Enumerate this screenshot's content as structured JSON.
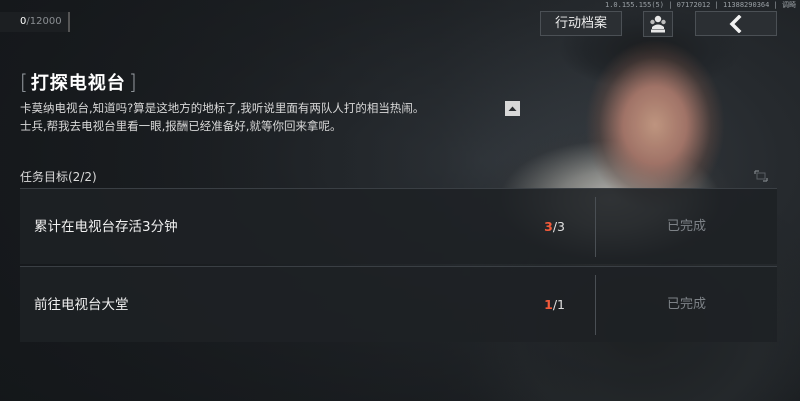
{
  "currency": {
    "current": "0",
    "max": "/12000"
  },
  "version_text": "1.0.155.155(5) | 07172012 | 11388290364 | 调畸",
  "top_buttons": {
    "archive_label": "行动档案",
    "squad_icon": "squad-icon",
    "back_icon": "chevron-left-icon"
  },
  "mission": {
    "title": "打探电视台",
    "bracket_left": "[",
    "bracket_right": "]",
    "description_line1": "卡莫纳电视台,知道吗?算是这地方的地标了,我听说里面有两队人打的相当热闹。",
    "description_line2": "士兵,帮我去电视台里看一眼,报酬已经准备好,就等你回来拿呢。"
  },
  "objectives": {
    "label": "任务目标(2/2)",
    "items": [
      {
        "name": "累计在电视台存活3分钟",
        "done": "3",
        "total": "/3",
        "status": "已完成"
      },
      {
        "name": "前往电视台大堂",
        "done": "1",
        "total": "/1",
        "status": "已完成"
      }
    ]
  },
  "colors": {
    "accent_progress": "#f25a3a",
    "panel_bg": "#1e2124",
    "status_text": "#7d8287"
  }
}
